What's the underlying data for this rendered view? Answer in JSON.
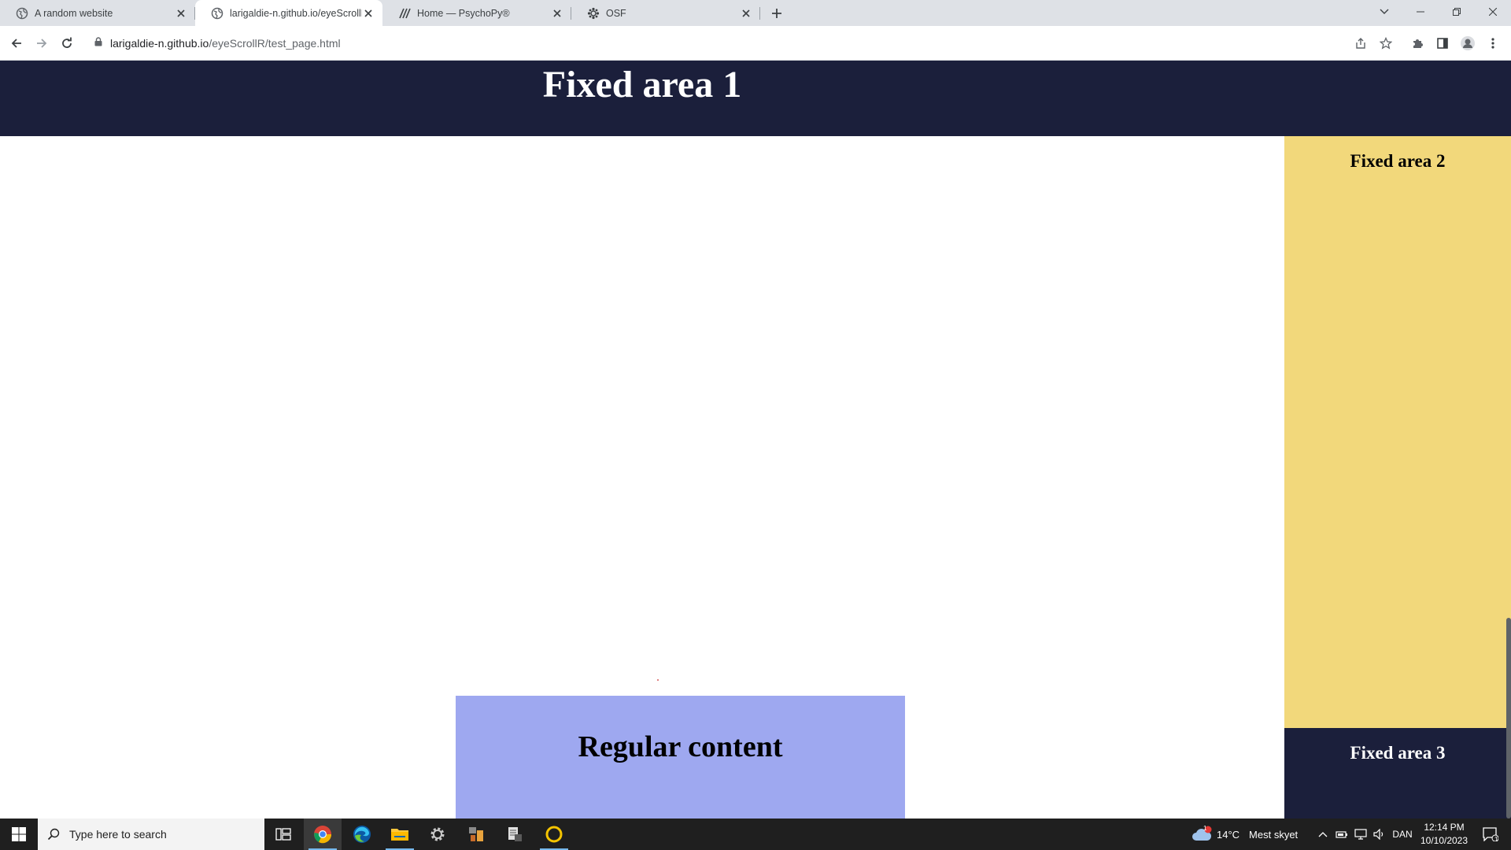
{
  "browser": {
    "tabs": [
      {
        "title": "A random website",
        "icon": "globe-icon",
        "active": false
      },
      {
        "title": "larigaldie-n.github.io/eyeScrollR",
        "icon": "globe-icon",
        "active": true
      },
      {
        "title": "Home — PsychoPy®",
        "icon": "psychopy-icon",
        "active": false
      },
      {
        "title": "OSF",
        "icon": "osf-icon",
        "active": false
      }
    ],
    "url_host": "larigaldie-n.github.io",
    "url_path": "/eyeScrollR/test_page.html"
  },
  "page": {
    "fixed_area_1": "Fixed area 1",
    "fixed_area_2": "Fixed area 2",
    "fixed_area_3": "Fixed area 3",
    "regular_content": "Regular content",
    "colors": {
      "navy": "#1b1f3b",
      "yellow": "#f2d87b",
      "lavender": "#9ea8f0"
    }
  },
  "taskbar": {
    "search_placeholder": "Type here to search",
    "weather_temp": "14°C",
    "weather_text": "Mest skyet",
    "weather_badge": "1",
    "language": "DAN",
    "time": "12:14 PM",
    "date": "10/10/2023",
    "notification_count": "1"
  }
}
